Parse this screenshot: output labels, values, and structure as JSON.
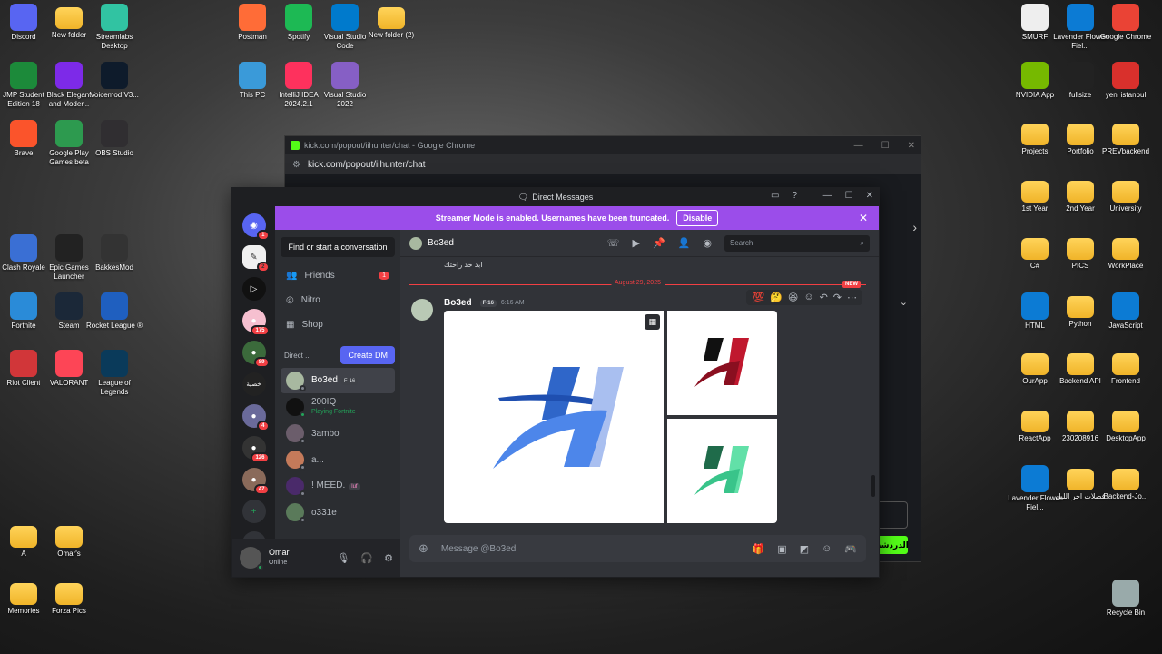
{
  "desktop_left": [
    {
      "label": "Discord",
      "icon": "discord-icon"
    },
    {
      "label": "New folder",
      "icon": "folder-icon"
    },
    {
      "label": "Streamlabs Desktop",
      "icon": "streamlabs-icon"
    },
    {
      "label": "JMP Student Edition 18",
      "icon": "jmp-icon"
    },
    {
      "label": "Black Elegant and Moder...",
      "icon": "canva-icon"
    },
    {
      "label": "Voicemod V3...",
      "icon": "voicemod-icon"
    },
    {
      "label": "Brave",
      "icon": "brave-icon"
    },
    {
      "label": "Google Play Games beta",
      "icon": "google-play-icon"
    },
    {
      "label": "OBS Studio",
      "icon": "obs-icon"
    },
    {
      "label": "Clash Royale",
      "icon": "clash-royale-icon"
    },
    {
      "label": "Epic Games Launcher",
      "icon": "epic-games-icon"
    },
    {
      "label": "BakkesMod",
      "icon": "bakkesmod-icon"
    },
    {
      "label": "Fortnite",
      "icon": "fortnite-icon"
    },
    {
      "label": "Steam",
      "icon": "steam-icon"
    },
    {
      "label": "Rocket League ®",
      "icon": "rocket-league-icon"
    },
    {
      "label": "Riot Client",
      "icon": "riot-client-icon"
    },
    {
      "label": "VALORANT",
      "icon": "valorant-icon"
    },
    {
      "label": "League of Legends",
      "icon": "league-icon"
    },
    {
      "label": "A",
      "icon": "folder-icon"
    },
    {
      "label": "Omar's",
      "icon": "folder-icon"
    },
    {
      "label": "Memories",
      "icon": "folder-icon"
    },
    {
      "label": "Forza Pics",
      "icon": "folder-icon"
    }
  ],
  "desktop_mid": [
    {
      "label": "Postman",
      "icon": "postman-icon"
    },
    {
      "label": "Spotify",
      "icon": "spotify-icon"
    },
    {
      "label": "Visual Studio Code",
      "icon": "vscode-icon"
    },
    {
      "label": "New folder (2)",
      "icon": "folder-icon"
    },
    {
      "label": "This PC",
      "icon": "this-pc-icon"
    },
    {
      "label": "IntelliJ IDEA 2024.2.1",
      "icon": "intellij-icon"
    },
    {
      "label": "Visual Studio 2022",
      "icon": "visual-studio-icon"
    }
  ],
  "desktop_right": [
    {
      "label": "SMURF",
      "icon": "file-icon"
    },
    {
      "label": "Lavender Flower Fiel...",
      "icon": "edge-icon"
    },
    {
      "label": "Google Chrome",
      "icon": "chrome-icon"
    },
    {
      "label": "NVIDIA App",
      "icon": "nvidia-icon"
    },
    {
      "label": "fullsize",
      "icon": "image-icon"
    },
    {
      "label": "yeni istanbul",
      "icon": "pdf-icon"
    },
    {
      "label": "Projects",
      "icon": "folder-icon"
    },
    {
      "label": "Portfolio",
      "icon": "folder-icon"
    },
    {
      "label": "PREVbackend",
      "icon": "folder-icon"
    },
    {
      "label": "1st Year",
      "icon": "folder-icon"
    },
    {
      "label": "2nd Year",
      "icon": "folder-icon"
    },
    {
      "label": "University",
      "icon": "folder-icon"
    },
    {
      "label": "C#",
      "icon": "folder-icon"
    },
    {
      "label": "PICS",
      "icon": "folder-icon"
    },
    {
      "label": "WorkPlace",
      "icon": "folder-icon"
    },
    {
      "label": "HTML",
      "icon": "edge-icon"
    },
    {
      "label": "Python",
      "icon": "folder-icon"
    },
    {
      "label": "JavaScript",
      "icon": "edge-icon"
    },
    {
      "label": "OurApp",
      "icon": "folder-icon"
    },
    {
      "label": "Backend API",
      "icon": "folder-icon"
    },
    {
      "label": "Frontend",
      "icon": "folder-icon"
    },
    {
      "label": "ReactApp",
      "icon": "folder-icon"
    },
    {
      "label": "230208916",
      "icon": "folder-icon"
    },
    {
      "label": "DesktopApp",
      "icon": "folder-icon"
    },
    {
      "label": "Lavender Flower Fiel...",
      "icon": "edge-icon"
    },
    {
      "label": "فصلات اخر الليل",
      "icon": "folder-icon"
    },
    {
      "label": "Backend-Jo...",
      "icon": "folder-icon"
    },
    {
      "label": "Recycle Bin",
      "icon": "recycle-bin-icon"
    }
  ],
  "chrome": {
    "title": "kick.com/popout/iihunter/chat - Google Chrome",
    "url": "kick.com/popout/iihunter/chat",
    "send_label": "الدردشة"
  },
  "discord": {
    "title": "Direct Messages",
    "streamer_banner": "Streamer Mode is enabled. Usernames have been truncated.",
    "disable_label": "Disable",
    "find_label": "Find or start a conversation",
    "nav": [
      {
        "label": "Friends",
        "badge": "1",
        "icon": "friends-icon"
      },
      {
        "label": "Nitro",
        "badge": "",
        "icon": "nitro-icon"
      },
      {
        "label": "Shop",
        "badge": "",
        "icon": "shop-icon"
      }
    ],
    "dm_header": "Direct ...",
    "create_dm": "Create DM",
    "dms": [
      {
        "name": "Bo3ed",
        "tag": "F-16",
        "sub": "",
        "status": "offline",
        "color": "#a8b8a0",
        "active": true
      },
      {
        "name": "200IQ",
        "tag": "",
        "sub": "Playing Fortnite",
        "status": "online",
        "color": "#111",
        "active": false
      },
      {
        "name": "3ambo",
        "tag": "",
        "sub": "",
        "status": "offline",
        "color": "#6b5d6b",
        "active": false
      },
      {
        "name": "a...",
        "tag": "",
        "sub": "",
        "status": "offline",
        "color": "#c47a5a",
        "active": false
      },
      {
        "name": "! MEED.",
        "tag": "luf",
        "sub": "",
        "status": "offline",
        "color": "#4a2a6a",
        "active": false
      },
      {
        "name": "o331e",
        "tag": "",
        "sub": "",
        "status": "offline",
        "color": "#5a7a5a",
        "active": false
      }
    ],
    "guild_badges": [
      "1",
      "2",
      "175",
      "89",
      "4",
      "126",
      "47"
    ],
    "user": {
      "name": "Omar",
      "status": "Online"
    },
    "channel_name": "Bo3ed",
    "search_placeholder": "Search",
    "old_message": "ابد خذ راحتك",
    "date_divider": "August 29, 2025",
    "new_label": "NEW",
    "message": {
      "author": "Bo3ed",
      "tag": "F-16",
      "time": "6:16 AM"
    },
    "composer_placeholder": "Message @Bo3ed"
  }
}
